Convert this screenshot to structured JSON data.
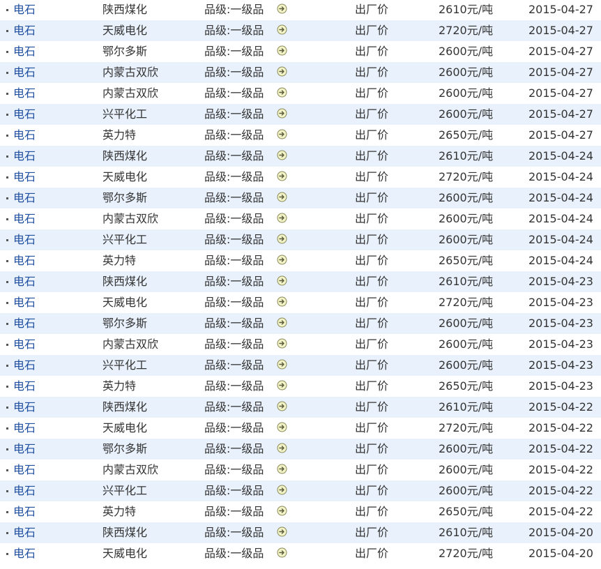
{
  "rows": [
    {
      "product": "电石",
      "company": "陕西煤化",
      "grade": "品级:一级品",
      "price_type": "出厂价",
      "price": "2610元/吨",
      "date": "2015-04-27"
    },
    {
      "product": "电石",
      "company": "天威电化",
      "grade": "品级:一级品",
      "price_type": "出厂价",
      "price": "2720元/吨",
      "date": "2015-04-27"
    },
    {
      "product": "电石",
      "company": "鄂尔多斯",
      "grade": "品级:一级品",
      "price_type": "出厂价",
      "price": "2600元/吨",
      "date": "2015-04-27"
    },
    {
      "product": "电石",
      "company": "内蒙古双欣",
      "grade": "品级:一级品",
      "price_type": "出厂价",
      "price": "2600元/吨",
      "date": "2015-04-27"
    },
    {
      "product": "电石",
      "company": "内蒙古双欣",
      "grade": "品级:一级品",
      "price_type": "出厂价",
      "price": "2600元/吨",
      "date": "2015-04-27"
    },
    {
      "product": "电石",
      "company": "兴平化工",
      "grade": "品级:一级品",
      "price_type": "出厂价",
      "price": "2600元/吨",
      "date": "2015-04-27"
    },
    {
      "product": "电石",
      "company": "英力特",
      "grade": "品级:一级品",
      "price_type": "出厂价",
      "price": "2650元/吨",
      "date": "2015-04-27"
    },
    {
      "product": "电石",
      "company": "陕西煤化",
      "grade": "品级:一级品",
      "price_type": "出厂价",
      "price": "2610元/吨",
      "date": "2015-04-24"
    },
    {
      "product": "电石",
      "company": "天威电化",
      "grade": "品级:一级品",
      "price_type": "出厂价",
      "price": "2720元/吨",
      "date": "2015-04-24"
    },
    {
      "product": "电石",
      "company": "鄂尔多斯",
      "grade": "品级:一级品",
      "price_type": "出厂价",
      "price": "2600元/吨",
      "date": "2015-04-24"
    },
    {
      "product": "电石",
      "company": "内蒙古双欣",
      "grade": "品级:一级品",
      "price_type": "出厂价",
      "price": "2600元/吨",
      "date": "2015-04-24"
    },
    {
      "product": "电石",
      "company": "兴平化工",
      "grade": "品级:一级品",
      "price_type": "出厂价",
      "price": "2600元/吨",
      "date": "2015-04-24"
    },
    {
      "product": "电石",
      "company": "英力特",
      "grade": "品级:一级品",
      "price_type": "出厂价",
      "price": "2650元/吨",
      "date": "2015-04-24"
    },
    {
      "product": "电石",
      "company": "陕西煤化",
      "grade": "品级:一级品",
      "price_type": "出厂价",
      "price": "2610元/吨",
      "date": "2015-04-23"
    },
    {
      "product": "电石",
      "company": "天威电化",
      "grade": "品级:一级品",
      "price_type": "出厂价",
      "price": "2720元/吨",
      "date": "2015-04-23"
    },
    {
      "product": "电石",
      "company": "鄂尔多斯",
      "grade": "品级:一级品",
      "price_type": "出厂价",
      "price": "2600元/吨",
      "date": "2015-04-23"
    },
    {
      "product": "电石",
      "company": "内蒙古双欣",
      "grade": "品级:一级品",
      "price_type": "出厂价",
      "price": "2600元/吨",
      "date": "2015-04-23"
    },
    {
      "product": "电石",
      "company": "兴平化工",
      "grade": "品级:一级品",
      "price_type": "出厂价",
      "price": "2600元/吨",
      "date": "2015-04-23"
    },
    {
      "product": "电石",
      "company": "英力特",
      "grade": "品级:一级品",
      "price_type": "出厂价",
      "price": "2650元/吨",
      "date": "2015-04-23"
    },
    {
      "product": "电石",
      "company": "陕西煤化",
      "grade": "品级:一级品",
      "price_type": "出厂价",
      "price": "2610元/吨",
      "date": "2015-04-22"
    },
    {
      "product": "电石",
      "company": "天威电化",
      "grade": "品级:一级品",
      "price_type": "出厂价",
      "price": "2720元/吨",
      "date": "2015-04-22"
    },
    {
      "product": "电石",
      "company": "鄂尔多斯",
      "grade": "品级:一级品",
      "price_type": "出厂价",
      "price": "2600元/吨",
      "date": "2015-04-22"
    },
    {
      "product": "电石",
      "company": "内蒙古双欣",
      "grade": "品级:一级品",
      "price_type": "出厂价",
      "price": "2600元/吨",
      "date": "2015-04-22"
    },
    {
      "product": "电石",
      "company": "兴平化工",
      "grade": "品级:一级品",
      "price_type": "出厂价",
      "price": "2600元/吨",
      "date": "2015-04-22"
    },
    {
      "product": "电石",
      "company": "英力特",
      "grade": "品级:一级品",
      "price_type": "出厂价",
      "price": "2650元/吨",
      "date": "2015-04-22"
    },
    {
      "product": "电石",
      "company": "陕西煤化",
      "grade": "品级:一级品",
      "price_type": "出厂价",
      "price": "2610元/吨",
      "date": "2015-04-20"
    },
    {
      "product": "电石",
      "company": "天威电化",
      "grade": "品级:一级品",
      "price_type": "出厂价",
      "price": "2720元/吨",
      "date": "2015-04-20"
    }
  ],
  "icons": {
    "detail": "arrow-circle-icon",
    "bullet": "bullet-square"
  },
  "colors": {
    "alt_row_bg": "#e9f1fc",
    "link_blue": "#1f4fa0",
    "icon_fill": "#f3f3c8",
    "icon_stroke": "#8a8a5a"
  }
}
